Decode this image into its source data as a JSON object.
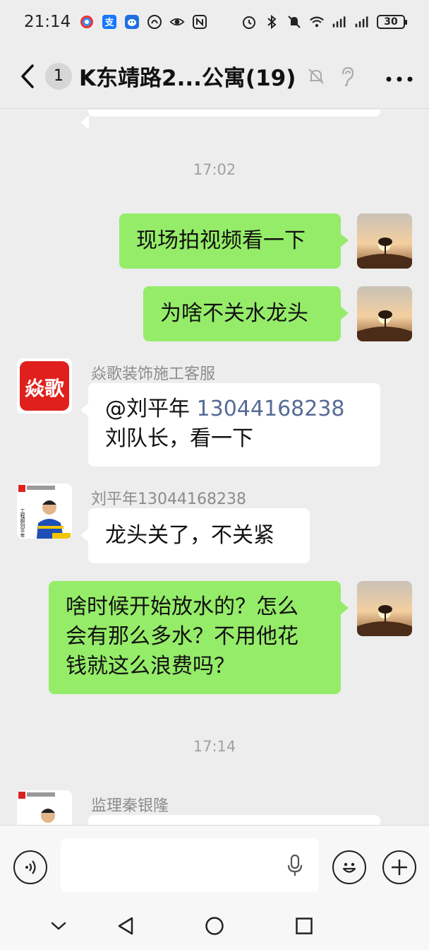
{
  "status_bar": {
    "time": "21:14",
    "battery": "30",
    "left_icons": [
      "app-icon-1",
      "alipay-icon",
      "app-icon-3",
      "app-icon-4",
      "eye-icon",
      "nfc-icon"
    ],
    "right_icons": [
      "alarm-icon",
      "bluetooth-icon",
      "mute-icon",
      "wifi-icon",
      "signal-icon",
      "signal-icon-2"
    ]
  },
  "header": {
    "unread_count": "1",
    "title": "K东靖路2...公寓(19)"
  },
  "messages": {
    "ts1": "17:02",
    "m1": "现场拍视频看一下",
    "m2": "为啥不关水龙头",
    "m3_sender": "焱歌装饰施工客服",
    "m3_line1_prefix": "@刘平年 ",
    "m3_line1_number": "13044168238",
    "m3_line2": "刘队长，看一下",
    "m4_sender": "刘平年13044168238",
    "m4": "龙头关了，不关紧",
    "m5_line1": "啥时候开始放水的？怎么",
    "m5_line2": "会有那么多水？不用他花",
    "m5_line3": "钱就这么浪费吗？",
    "ts2": "17:14",
    "m6_sender": "监理秦银隆"
  },
  "avatars": {
    "logo_text": "焱歌",
    "worker_caption_top": "工程部刘平年",
    "worker_caption_bottom": "施工队长",
    "supervisor_caption": "工程部秦银"
  },
  "colors": {
    "background": "#ededed",
    "self_bubble": "#95ec69",
    "other_bubble": "#ffffff",
    "mention": "#576b95"
  }
}
